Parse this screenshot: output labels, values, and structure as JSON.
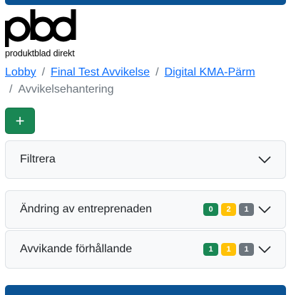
{
  "colors": {
    "brand_blue": "#0b5394",
    "link": "#0d6efd",
    "success": "#198754",
    "warning": "#ffc107",
    "secondary": "#6c757d"
  },
  "logo": {
    "mark": "pbd",
    "subtitle": "produktblad direkt"
  },
  "breadcrumb": {
    "items": [
      {
        "label": "Lobby"
      },
      {
        "label": "Final Test Avvikelse"
      },
      {
        "label": "Digital KMA-Pärm"
      }
    ],
    "current": "Avvikelsehantering",
    "separator": "/"
  },
  "add_button": {
    "label": "+",
    "icon": "plus-icon"
  },
  "filter": {
    "label": "Filtrera",
    "icon": "chevron-down-icon"
  },
  "categories": [
    {
      "label": "Ändring av entreprenaden",
      "counts": {
        "green": "0",
        "yellow": "2",
        "gray": "1"
      },
      "icon": "chevron-down-icon"
    },
    {
      "label": "Avvikande förhållande",
      "counts": {
        "green": "1",
        "yellow": "1",
        "gray": "1"
      },
      "icon": "chevron-down-icon"
    }
  ]
}
